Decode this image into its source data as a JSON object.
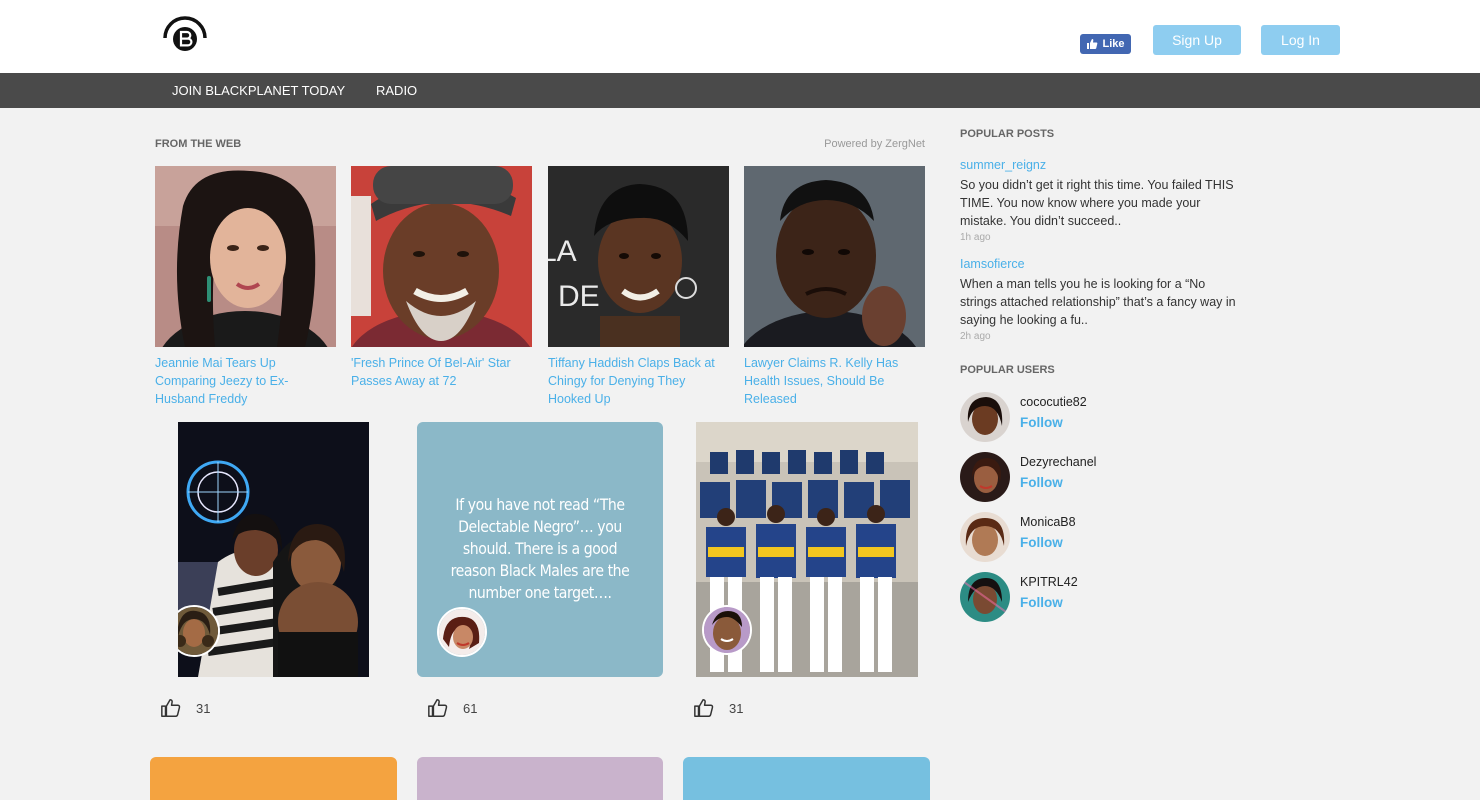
{
  "header": {
    "fb_like": "Like",
    "sign_up": "Sign Up",
    "log_in": "Log In"
  },
  "nav": {
    "join": "JOIN BLACKPLANET TODAY",
    "radio": "RADIO"
  },
  "from_web": {
    "heading": "FROM THE WEB",
    "powered_by": "Powered by ZergNet",
    "items": [
      {
        "title": "Jeannie Mai Tears Up Comparing Jeezy to Ex-Husband Freddy"
      },
      {
        "title": "'Fresh Prince Of Bel-Air' Star Passes Away at 72"
      },
      {
        "title": "Tiffany Haddish Claps Back at Chingy for Denying They Hooked Up"
      },
      {
        "title": "Lawyer Claims R. Kelly Has Health Issues, Should Be Released"
      }
    ]
  },
  "posts": [
    {
      "likes": "31"
    },
    {
      "quote": "If you have not read “The Delectable Negro”… you should. There is a good reason Black Males are the number one target….",
      "likes": "61"
    },
    {
      "likes": "31"
    }
  ],
  "popular_posts": {
    "heading": "POPULAR POSTS",
    "items": [
      {
        "user": "summer_reignz",
        "text": "So you didn’t get it right this time. You failed THIS TIME. You now know where you made your mistake. You didn’t succeed..",
        "time": "1h ago"
      },
      {
        "user": "Iamsofierce",
        "text": "When a man tells you he is looking for a “No strings attached relationship” that’s a fancy way in saying he looking a fu..",
        "time": "2h ago"
      }
    ]
  },
  "popular_users": {
    "heading": "POPULAR USERS",
    "follow_label": "Follow",
    "items": [
      {
        "name": "cococutie82"
      },
      {
        "name": "Dezyrechanel"
      },
      {
        "name": "MonicaB8"
      },
      {
        "name": "KPITRL42"
      }
    ]
  },
  "colors": {
    "accent": "#8ecdf0",
    "link": "#4ab0e8",
    "nav_bg": "#4a4a4a",
    "quote_card": "#8bb8c8",
    "bottom_cards": [
      "#f4a340",
      "#c9b3cc",
      "#76c0e0"
    ]
  }
}
